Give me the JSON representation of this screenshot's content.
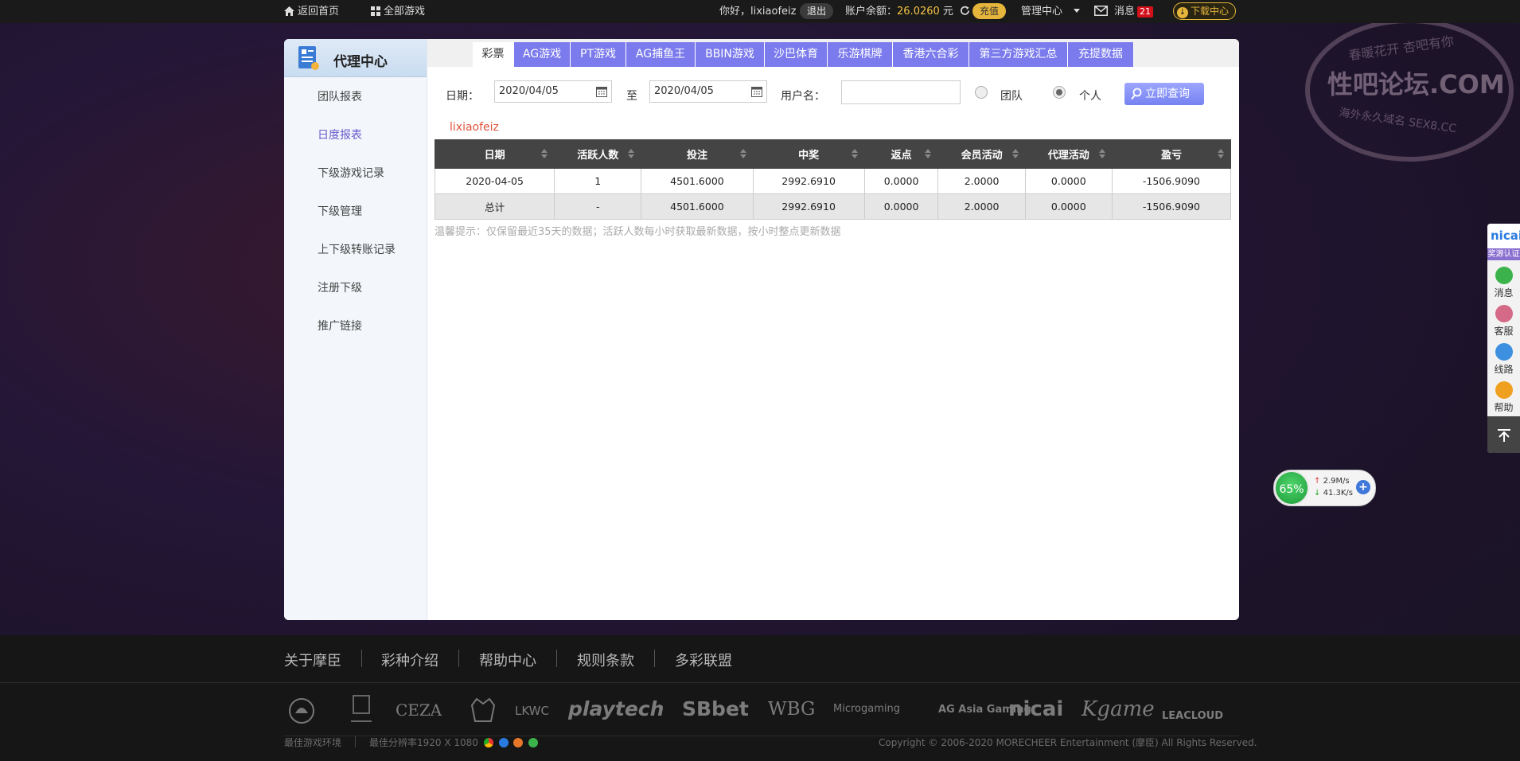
{
  "topbar": {
    "home_label": "返回首页",
    "all_games_label": "全部游戏",
    "greeting": "你好，lixiaofeiz",
    "logout_label": "退出",
    "balance_label": "账户余额：",
    "balance_value": "26.0260",
    "balance_unit": "元",
    "recharge_label": "充值",
    "manage_label": "管理中心",
    "message_label": "消息",
    "message_count": "21",
    "download_label": "下载中心"
  },
  "sidebar": {
    "title": "代理中心",
    "items": [
      {
        "label": "团队报表"
      },
      {
        "label": "日度报表"
      },
      {
        "label": "下级游戏记录"
      },
      {
        "label": "下级管理"
      },
      {
        "label": "上下级转账记录"
      },
      {
        "label": "注册下级"
      },
      {
        "label": "推广链接"
      }
    ],
    "active": "日度报表"
  },
  "tabs": [
    {
      "label": "彩票",
      "active": true
    },
    {
      "label": "AG游戏"
    },
    {
      "label": "PT游戏"
    },
    {
      "label": "AG捕鱼王"
    },
    {
      "label": "BBIN游戏"
    },
    {
      "label": "沙巴体育"
    },
    {
      "label": "乐游棋牌"
    },
    {
      "label": "香港六合彩"
    },
    {
      "label": "第三方游戏汇总"
    },
    {
      "label": "充提数据"
    }
  ],
  "filters": {
    "date_label": "日期：",
    "date_from": "2020/04/05",
    "to_label": "至",
    "date_to": "2020/04/05",
    "username_label": "用户名：",
    "username_value": "",
    "team_label": "团队",
    "personal_label": "个人",
    "selected_scope": "个人",
    "query_label": "立即查询"
  },
  "current_user": "lixiaofeiz",
  "table": {
    "headers": [
      "日期",
      "活跃人数",
      "投注",
      "中奖",
      "返点",
      "会员活动",
      "代理活动",
      "盈亏"
    ],
    "rows": [
      [
        "2020-04-05",
        "1",
        "4501.6000",
        "2992.6910",
        "0.0000",
        "2.0000",
        "0.0000",
        "-1506.9090"
      ],
      [
        "总计",
        "-",
        "4501.6000",
        "2992.6910",
        "0.0000",
        "2.0000",
        "0.0000",
        "-1506.9090"
      ]
    ]
  },
  "tip": "温馨提示：仅保留最近35天的数据；活跃人数每小时获取最新数据，按小时整点更新数据",
  "footer": {
    "links": [
      "关于摩臣",
      "彩种介绍",
      "帮助中心",
      "规则条款",
      "多彩联盟"
    ],
    "logos": [
      "CEZA",
      "LKWC",
      "playtech",
      "SBbet",
      "WBG",
      "Microgaming",
      "AG Asia Gaming",
      "nicai",
      "Kgame",
      "LEACLOUD"
    ],
    "env_label": "最佳游戏环境",
    "resolution_label": "最佳分辨率1920 X 1080",
    "copyright": "Copyright © 2006-2020 MORECHEER Entertainment (摩臣) All Rights Reserved."
  },
  "floatbar": {
    "badge_label": "奖源认证",
    "items": [
      {
        "label": "消息",
        "icon": "chat-icon",
        "color": "#3cb34a"
      },
      {
        "label": "客服",
        "icon": "agent-icon",
        "color": "#d46a86"
      },
      {
        "label": "线路",
        "icon": "speedometer-icon",
        "color": "#3d8fe0"
      },
      {
        "label": "帮助",
        "icon": "help-icon",
        "color": "#f0a020"
      }
    ]
  },
  "speed_widget": {
    "percent": "65%",
    "up": "2.9M/s",
    "down": "41.3K/s"
  },
  "watermark": {
    "main": "性吧论坛.COM",
    "top": "春暖花开 杏吧有你",
    "bottom": "海外永久域名 SEX8.CC"
  }
}
